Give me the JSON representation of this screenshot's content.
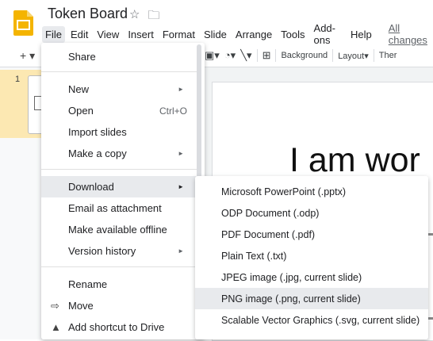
{
  "app": {
    "doc_title": "Token Board",
    "star_icon": "star-icon",
    "folder_icon": "move-folder-icon"
  },
  "menubar": {
    "items": [
      "File",
      "Edit",
      "View",
      "Insert",
      "Format",
      "Slide",
      "Arrange",
      "Tools",
      "Add-ons",
      "Help"
    ],
    "edits_link": "All changes"
  },
  "toolbar": {
    "background_label": "Background",
    "layout_label": "Layout",
    "theme_label": "Ther"
  },
  "filmstrip": {
    "slide_number": "1"
  },
  "slide": {
    "text": "I am wor"
  },
  "file_menu": {
    "share": "Share",
    "new": "New",
    "open": "Open",
    "open_shortcut": "Ctrl+O",
    "import_slides": "Import slides",
    "make_a_copy": "Make a copy",
    "download": "Download",
    "email_as_attachment": "Email as attachment",
    "make_available_offline": "Make available offline",
    "version_history": "Version history",
    "rename": "Rename",
    "move": "Move",
    "add_shortcut": "Add shortcut to Drive"
  },
  "download_submenu": {
    "items": [
      "Microsoft PowerPoint (.pptx)",
      "ODP Document (.odp)",
      "PDF Document (.pdf)",
      "Plain Text (.txt)",
      "JPEG image (.jpg, current slide)",
      "PNG image (.png, current slide)",
      "Scalable Vector Graphics (.svg, current slide)"
    ],
    "highlighted_index": 5
  },
  "colors": {
    "logo": "#f4b400",
    "slide_selection": "#fce8b2",
    "hover": "#e8eaed"
  }
}
